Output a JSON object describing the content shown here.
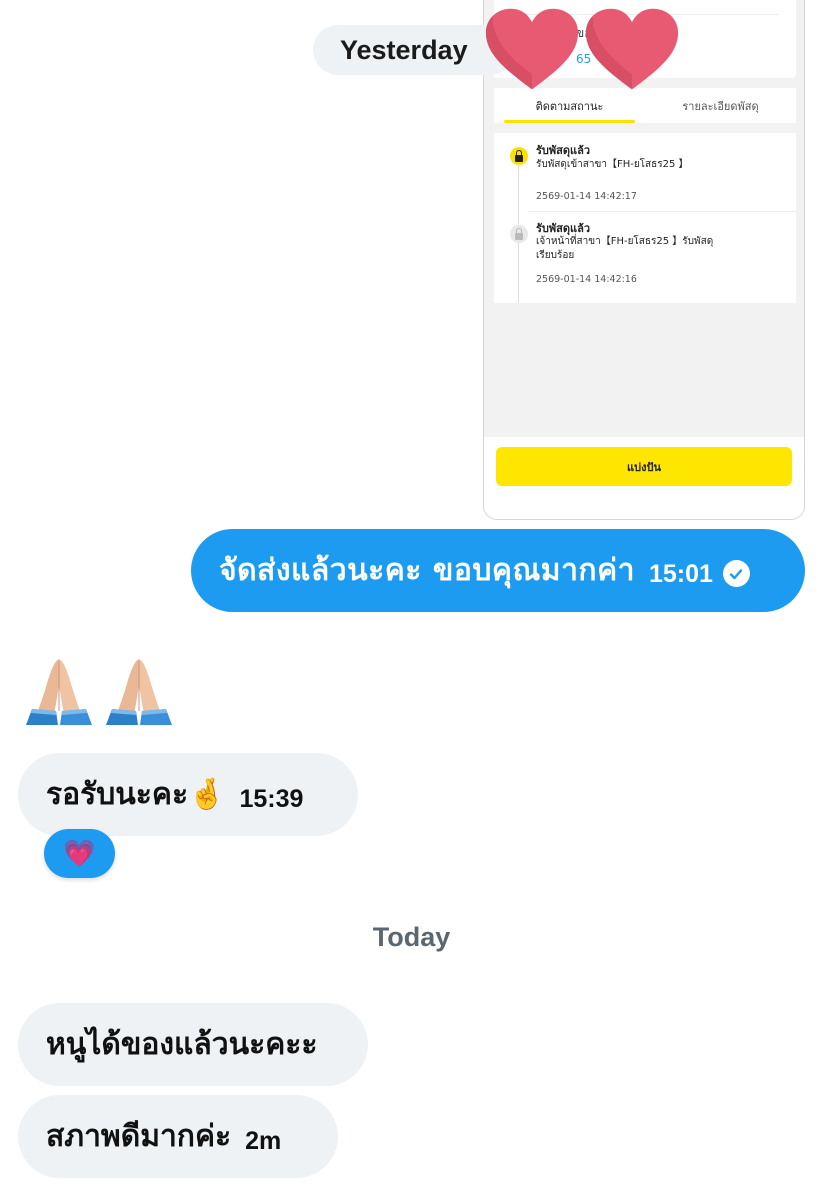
{
  "attachment": {
    "partial_label": "ของ",
    "partial_number": "65",
    "tabs": [
      {
        "label": "ติดตามสถานะ",
        "active": true
      },
      {
        "label": "รายละเอียดพัสดุ",
        "active": false
      }
    ],
    "timeline": [
      {
        "title": "รับพัสดุแล้ว",
        "description": "รับพัสดุเข้าสาขา【FH-ยโสธร25 】",
        "time": "2569-01-14 14:42:17",
        "state": "active"
      },
      {
        "title": "รับพัสดุแล้ว",
        "description": "เจ้าหน้าที่สาขา【FH-ยโสธร25 】รับพัสดุเรียบร้อย",
        "time": "2569-01-14 14:42:16",
        "state": "done"
      }
    ],
    "share_label": "แบ่งปัน",
    "accent_color": "#ffe600"
  },
  "date_separators": {
    "yesterday": "Yesterday",
    "today": "Today"
  },
  "messages": {
    "out_1": {
      "text": "จัดส่งแล้วนะคะ ขอบคุณมากค่า",
      "time": "15:01",
      "status_icon": "read-check-icon"
    },
    "emoji_row": [
      "folded-hands",
      "folded-hands"
    ],
    "in_1": {
      "text": "รอรับนะคะ🤞",
      "time": "15:39"
    },
    "reaction": {
      "emoji": "💗",
      "icon": "pink-heart-icon"
    },
    "in_2": {
      "text": "หนูได้ของแล้วนะคะะ"
    },
    "in_3": {
      "text": "สภาพดีมากค่ะ",
      "time": "2m"
    }
  },
  "colors": {
    "outgoing_bubble": "#1d9bf0",
    "incoming_bubble": "#eff2f4",
    "heart": "#e85a72"
  }
}
